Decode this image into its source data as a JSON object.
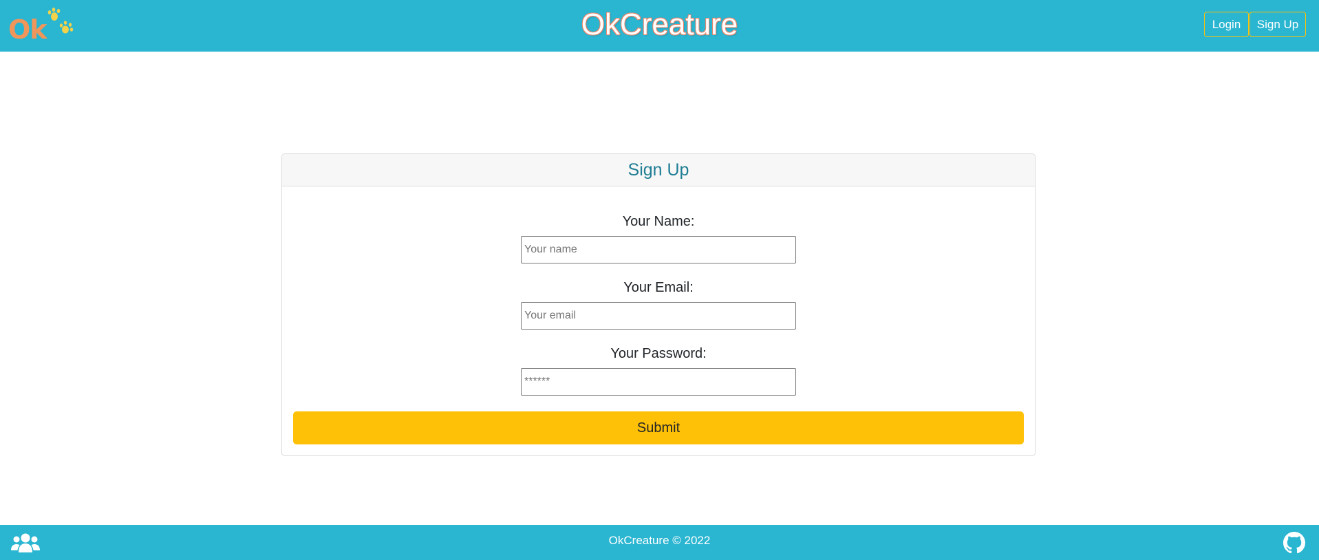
{
  "header": {
    "logo_text": "Ok",
    "brand": "OkCreature",
    "login_label": "Login",
    "signup_label": "Sign Up"
  },
  "form": {
    "title": "Sign Up",
    "name_label": "Your Name:",
    "name_placeholder": "Your name",
    "name_value": "",
    "email_label": "Your Email:",
    "email_placeholder": "Your email",
    "email_value": "",
    "password_label": "Your Password:",
    "password_placeholder": "******",
    "password_value": "",
    "submit_label": "Submit"
  },
  "footer": {
    "copyright": "OkCreature © 2022",
    "left_icon": "users-icon",
    "right_icon": "github-icon"
  },
  "colors": {
    "header_bg": "#2ab5d1",
    "accent_yellow": "#ffc107",
    "logo_orange": "#f0965a",
    "title_teal": "#1f7e94"
  }
}
